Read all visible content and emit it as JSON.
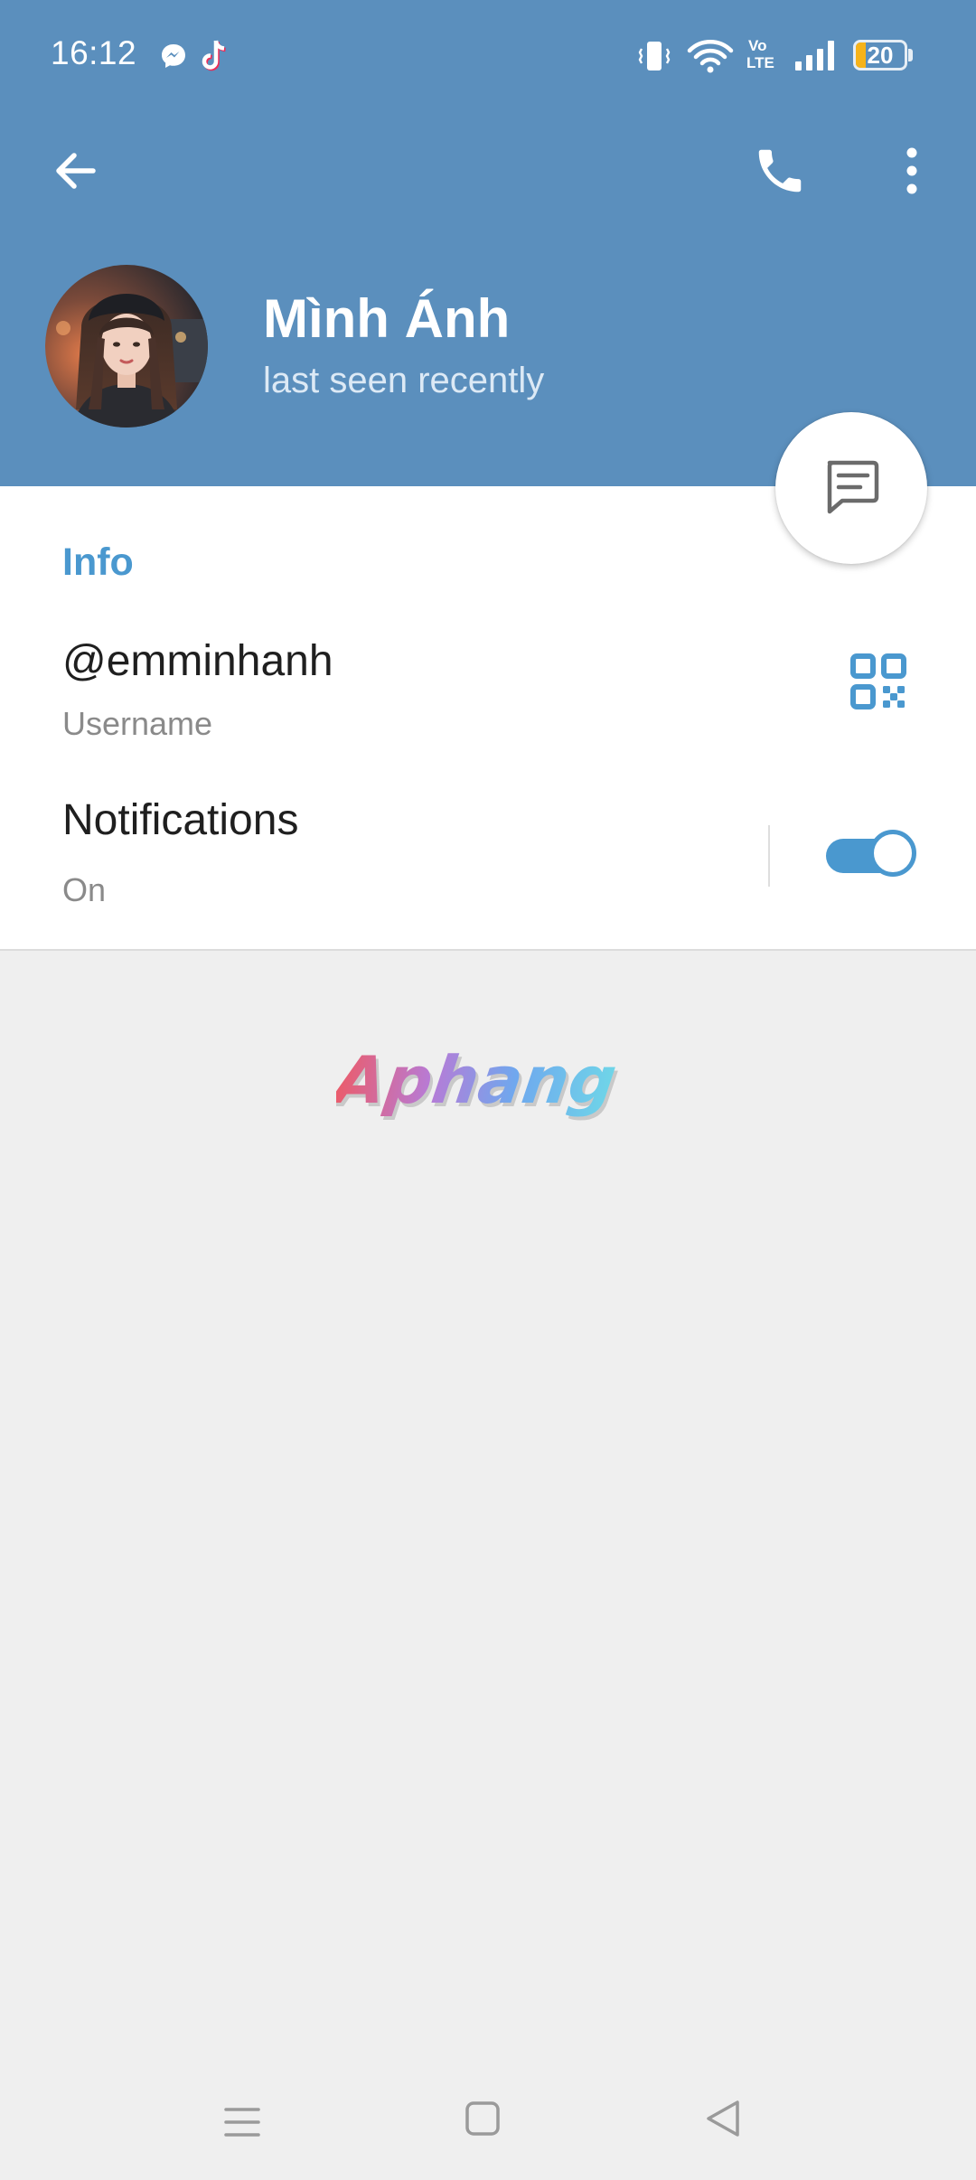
{
  "status_bar": {
    "time": "16:12",
    "battery_level": "20",
    "battery_fraction": 0.2,
    "icons": [
      "messenger-icon",
      "tiktok-icon",
      "vibrate-icon",
      "wifi-icon",
      "volte-icon",
      "signal-icon",
      "battery-icon"
    ],
    "volte_label_top": "Vo",
    "volte_label_bottom": "LTE"
  },
  "toolbar": {
    "back_icon": "arrow-left-icon",
    "call_icon": "phone-icon",
    "menu_icon": "more-vertical-icon"
  },
  "profile": {
    "name": "Mình Ánh",
    "status": "last seen recently"
  },
  "fab": {
    "icon": "message-icon"
  },
  "info": {
    "title": "Info",
    "username_value": "@emminhanh",
    "username_label": "Username",
    "qr_icon": "qr-code-icon",
    "notifications_label": "Notifications",
    "notifications_value": "On",
    "notifications_enabled": true
  },
  "watermark": {
    "text": "Aphang"
  },
  "nav_bar": {
    "icons": [
      "menu-icon",
      "home-square-icon",
      "back-triangle-icon"
    ]
  },
  "colors": {
    "header_blue": "#5b8fbd",
    "accent_blue": "#4a98cf",
    "background": "#efefef",
    "battery_yellow": "#f6b31a"
  }
}
